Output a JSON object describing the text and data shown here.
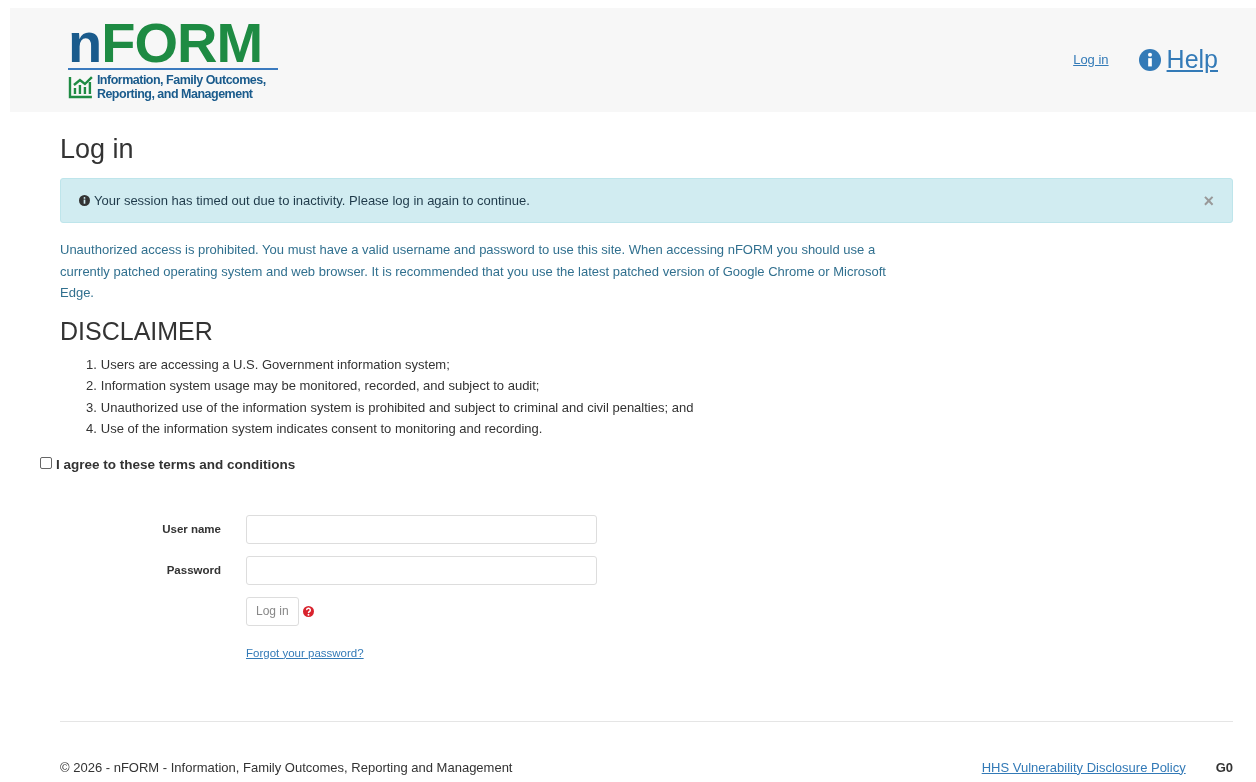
{
  "header": {
    "logo": {
      "title_parts": [
        "n",
        "FORM"
      ],
      "tagline": "Information, Family Outcomes, Reporting, and Management"
    },
    "nav": [
      {
        "kind": "link",
        "label": "Log in"
      },
      {
        "kind": "help",
        "label": "Help"
      }
    ]
  },
  "page_title": "Log in",
  "alert": {
    "message": "Your session has timed out due to inactivity. Please log in again to continue.",
    "close": "×"
  },
  "notice": "Unauthorized access is prohibited. You must have a valid username and password to use this site. When accessing nFORM you should use a currently patched operating system and web browser. It is recommended that you use the latest patched version of Google Chrome or Microsoft Edge.",
  "disclaimer": {
    "title": "DISCLAIMER",
    "items": [
      {
        "number": "1.",
        "text": "Users are accessing a U.S. Government information system;"
      },
      {
        "number": "2.",
        "text": "Information system usage may be monitored, recorded, and subject to audit;"
      },
      {
        "number": "3.",
        "text": "Unauthorized use of the information system is prohibited and subject to criminal and civil penalties; and"
      },
      {
        "number": "4.",
        "text": "Use of the information system indicates consent to monitoring and recording."
      }
    ]
  },
  "agree": {
    "label": "I agree to these terms and conditions",
    "checked": false
  },
  "form": {
    "fields": [
      {
        "label": "User name"
      },
      {
        "label": "Password"
      }
    ],
    "submit": "Log in",
    "disabled": true,
    "forgot": "Forgot your password?"
  },
  "footer": {
    "copyright": "© 2026 - nFORM - Information, Family Outcomes, Reporting and Management",
    "link": "HHS Vulnerability Disclosure Policy",
    "code": "G0"
  }
}
